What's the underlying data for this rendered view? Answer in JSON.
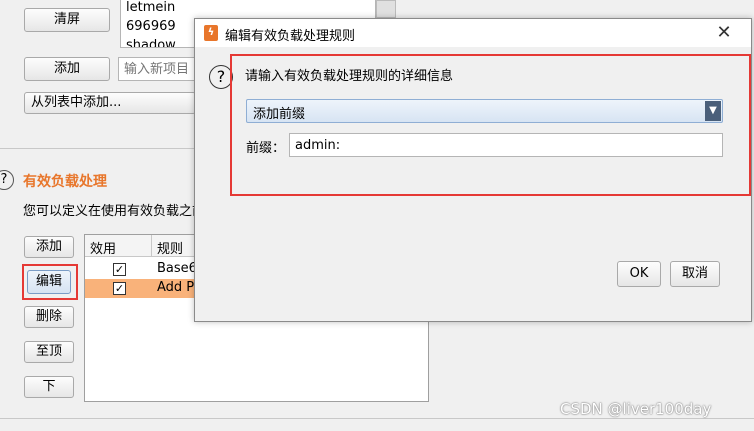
{
  "bg": {
    "clear_button": "清屏",
    "wordlist": [
      "letmein",
      "696969",
      "shadow"
    ],
    "add_button": "添加",
    "new_item_placeholder": "输入新项目",
    "add_from_list": "从列表中添加...",
    "section_title": "有效负载处理",
    "section_desc": "您可以定义在使用有效负载之前",
    "rule_buttons": {
      "add": "添加",
      "edit": "编辑",
      "remove": "删除",
      "top": "至顶",
      "down": "下"
    },
    "table": {
      "headers": [
        "效用",
        "规则"
      ],
      "rows": [
        {
          "checked": true,
          "rule": "Base6"
        },
        {
          "checked": true,
          "rule": "Add P"
        }
      ]
    }
  },
  "dialog": {
    "title": "编辑有效负载处理规则",
    "prompt": "请输入有效负载处理规则的详细信息",
    "rule_type": "添加前缀",
    "prefix_label": "前缀：",
    "prefix_value": "admin:",
    "ok": "OK",
    "cancel": "取消"
  },
  "watermark": "CSDN @liver100day",
  "colors": {
    "accent_orange": "#e8762b",
    "highlight_red": "#e53935",
    "selected_row": "#f9b27a"
  }
}
